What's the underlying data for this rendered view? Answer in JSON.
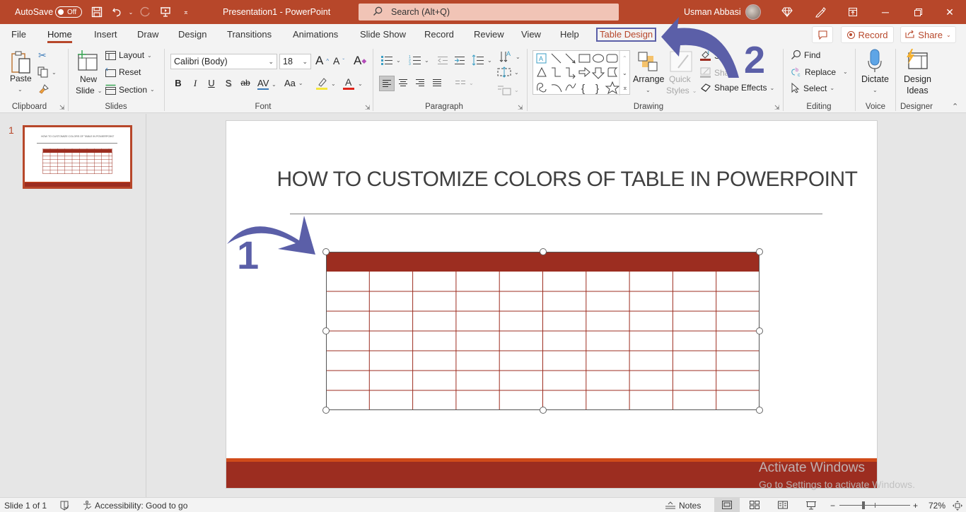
{
  "titlebar": {
    "autosave_label": "AutoSave",
    "autosave_state": "Off",
    "doc_title": "Presentation1  -  PowerPoint",
    "search_placeholder": "Search (Alt+Q)",
    "user_name": "Usman Abbasi",
    "color": "#b7472a"
  },
  "tabs": [
    {
      "label": "File"
    },
    {
      "label": "Home",
      "active": true
    },
    {
      "label": "Insert"
    },
    {
      "label": "Draw"
    },
    {
      "label": "Design"
    },
    {
      "label": "Transitions"
    },
    {
      "label": "Animations"
    },
    {
      "label": "Slide Show"
    },
    {
      "label": "Record"
    },
    {
      "label": "Review"
    },
    {
      "label": "View"
    },
    {
      "label": "Help"
    },
    {
      "label": "Table Design",
      "highlighted": true
    }
  ],
  "tab_actions": {
    "record_label": "Record",
    "share_label": "Share"
  },
  "ribbon": {
    "clipboard": {
      "label": "Clipboard",
      "paste": "Paste"
    },
    "slides": {
      "label": "Slides",
      "new_slide_line1": "New",
      "new_slide_line2": "Slide",
      "layout": "Layout",
      "reset": "Reset",
      "section": "Section"
    },
    "font": {
      "label": "Font",
      "font_name": "Calibri (Body)",
      "font_size": "18",
      "bold": "B",
      "italic": "I",
      "underline": "U",
      "shadow": "S",
      "strike": "ab",
      "spacing": "AV",
      "change_case": "Aa"
    },
    "paragraph": {
      "label": "Paragraph"
    },
    "drawing": {
      "label": "Drawing",
      "arrange": "Arrange",
      "quick_styles_line1": "Quick",
      "quick_styles_line2": "Styles",
      "shape_fill": "Sh",
      "shape_outline": "Shap",
      "shape_effects": "Shape Effects"
    },
    "editing": {
      "label": "Editing",
      "find": "Find",
      "replace": "Replace",
      "select": "Select"
    },
    "voice": {
      "label": "Voice",
      "dictate": "Dictate"
    },
    "designer": {
      "label": "Designer",
      "design_ideas_line1": "Design",
      "design_ideas_line2": "Ideas"
    }
  },
  "thumbnail": {
    "number": "1",
    "title": "HOW TO CUSTOMIZE COLORS OF   TABLE IN POWERPOINT"
  },
  "slide": {
    "title": "HOW TO CUSTOMIZE COLORS OF   TABLE IN POWERPOINT",
    "table": {
      "columns": 10,
      "header_rows": 1,
      "body_rows": 7,
      "header_color": "#9c2d20",
      "line_color": "#9c2d20"
    },
    "footer_colors": {
      "band_top": "#d04b1a",
      "band_main": "#9c2d20"
    }
  },
  "annotations": [
    {
      "label": "1",
      "target": "table"
    },
    {
      "label": "2",
      "target": "Table Design tab"
    }
  ],
  "annotation_color": "#5b5fa8",
  "watermark": {
    "line1": "Activate Windows",
    "line2": "Go to Settings to activate Windows."
  },
  "statusbar": {
    "slide_info": "Slide 1 of 1",
    "accessibility": "Accessibility: Good to go",
    "notes": "Notes",
    "zoom": "72%",
    "zoom_level_percent": 72
  }
}
